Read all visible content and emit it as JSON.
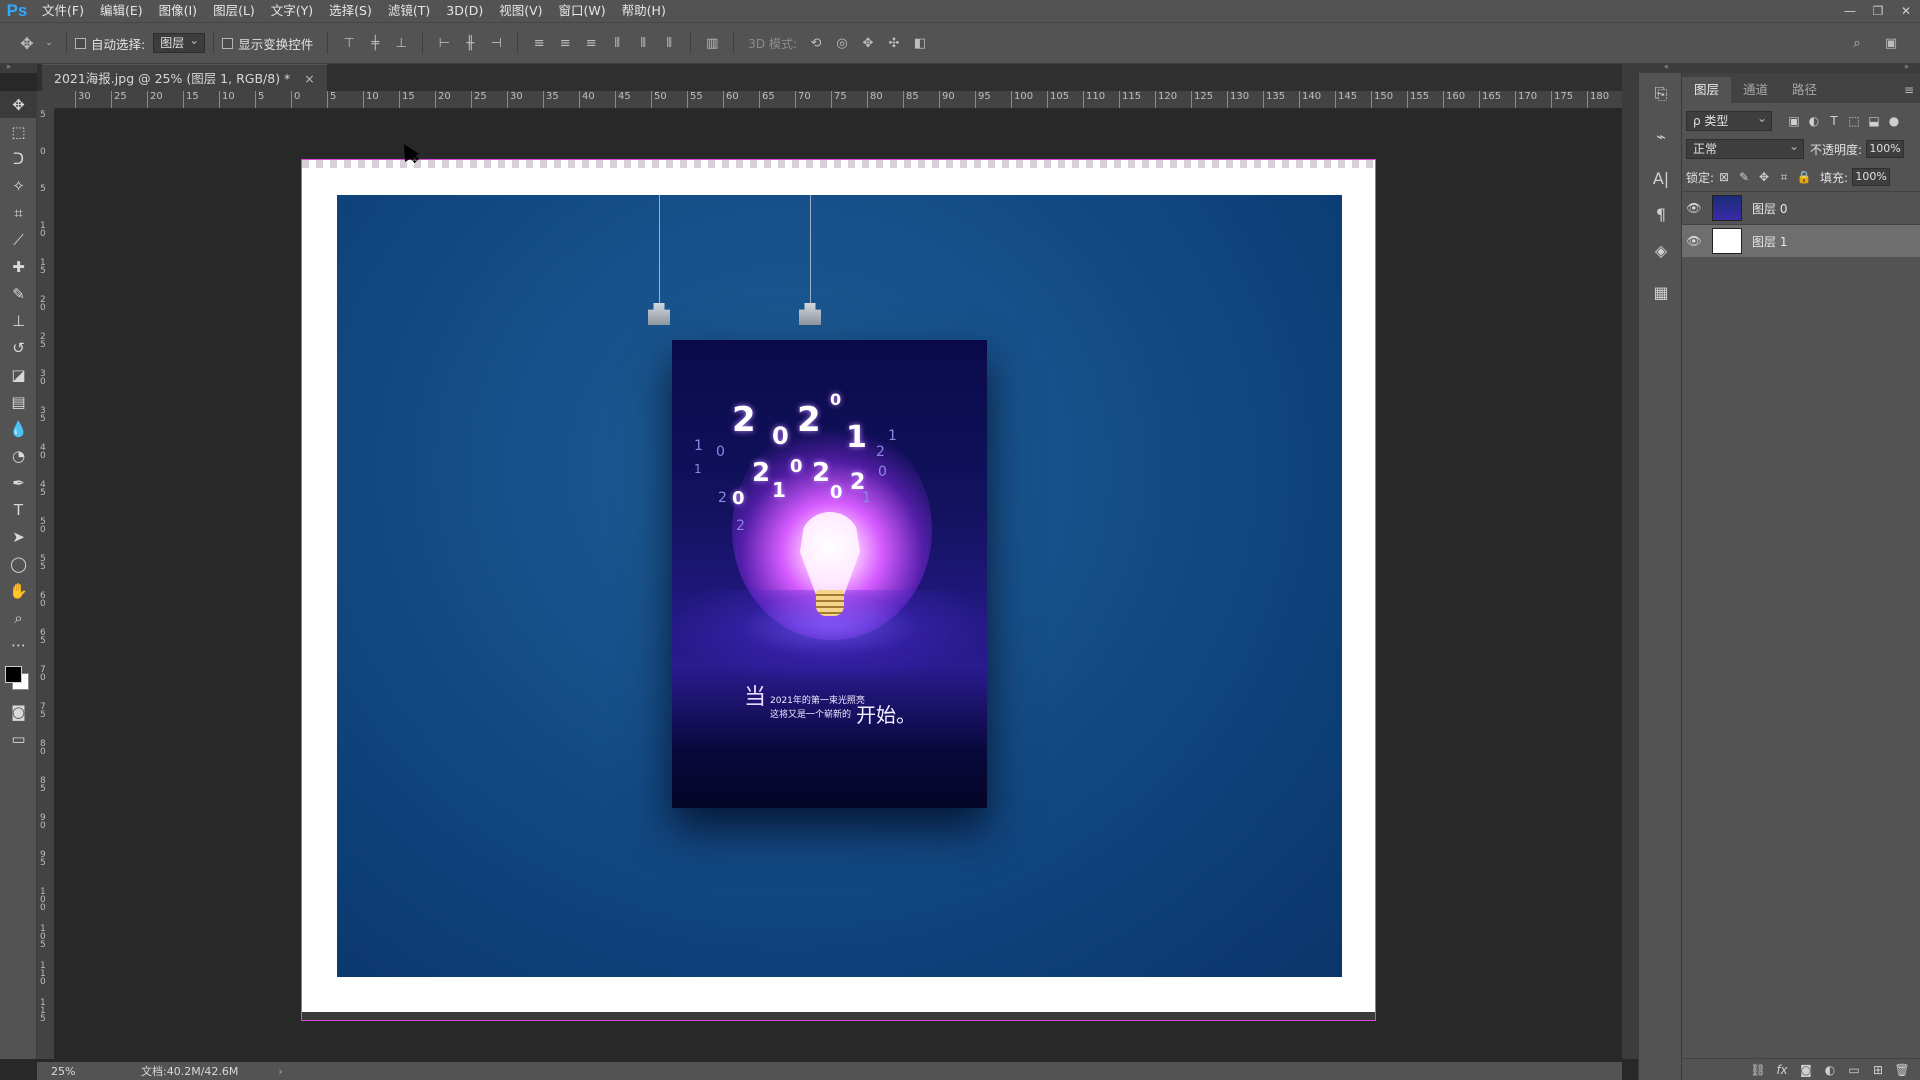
{
  "app": {
    "logo": "Ps",
    "menu": [
      "文件(F)",
      "编辑(E)",
      "图像(I)",
      "图层(L)",
      "文字(Y)",
      "选择(S)",
      "滤镜(T)",
      "3D(D)",
      "视图(V)",
      "窗口(W)",
      "帮助(H)"
    ],
    "window_controls": [
      "—",
      "❐",
      "✕"
    ]
  },
  "options": {
    "auto_select_label": "自动选择:",
    "auto_select_value": "图层",
    "show_transform_label": "显示变换控件",
    "mode_3d_label": "3D 模式:"
  },
  "document": {
    "tab_title": "2021海报.jpg @ 25% (图层 1, RGB/8) *",
    "tab_close": "×"
  },
  "ruler": {
    "top_labels": [
      "30",
      "25",
      "20",
      "15",
      "10",
      "5",
      "0",
      "5",
      "10",
      "15",
      "20",
      "25",
      "30",
      "35",
      "40",
      "45",
      "50",
      "55",
      "60",
      "65",
      "70",
      "75",
      "80",
      "85",
      "90",
      "95",
      "100",
      "105",
      "110",
      "115",
      "120",
      "125",
      "130",
      "135",
      "140",
      "145",
      "150",
      "155",
      "160",
      "165",
      "170",
      "175",
      "180"
    ],
    "left_labels": [
      "5",
      "0",
      "5",
      "1 0",
      "1 5",
      "2 0",
      "2 5",
      "3 0",
      "3 5",
      "4 0",
      "4 5",
      "5 0",
      "5 5",
      "6 0",
      "6 5",
      "7 0",
      "7 5",
      "8 0",
      "8 5",
      "9 0",
      "9 5",
      "1 0 0",
      "1 0 5",
      "1 1 0",
      "1 1 5"
    ]
  },
  "poster": {
    "big_char": "当",
    "line1": "2021年的第一束光照亮",
    "line2": "这将又是一个崭新的",
    "big_text": "开始。"
  },
  "status": {
    "zoom": "25%",
    "doc_size": "文档:40.2M/42.6M",
    "arrow": "›"
  },
  "layers_panel": {
    "tabs": [
      "图层",
      "通道",
      "路径"
    ],
    "filter_kind": "ρ 类型",
    "blend_mode": "正常",
    "opacity_label": "不透明度:",
    "opacity_value": "100%",
    "lock_label": "锁定:",
    "fill_label": "填充:",
    "fill_value": "100%",
    "layers": [
      {
        "name": "图层 0",
        "visible": true,
        "selected": false
      },
      {
        "name": "图层 1",
        "visible": true,
        "selected": true
      }
    ]
  },
  "colors": {
    "accent": "#31a8ff",
    "canvas_blue": "#17508a",
    "selection_border": "#d64ad6"
  }
}
